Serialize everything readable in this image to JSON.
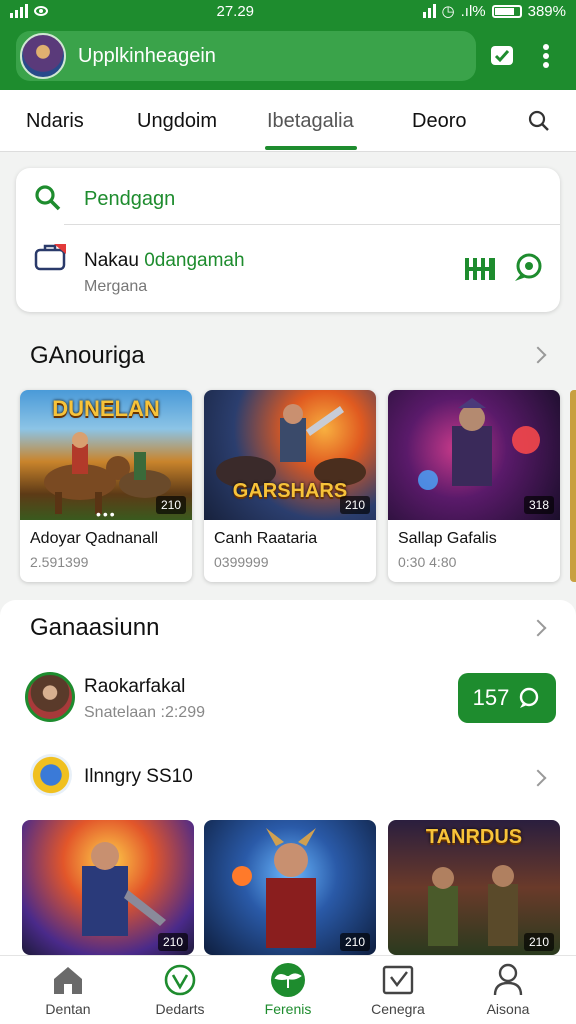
{
  "status_bar": {
    "time": "27.29",
    "battery": "389%",
    "extra": ".ıl%"
  },
  "app_bar": {
    "title": "Upplkinheagein"
  },
  "tabs": [
    {
      "label": "Ndaris"
    },
    {
      "label": "Ungdoim"
    },
    {
      "label": "Ibetagalia"
    },
    {
      "label": "Deoro"
    }
  ],
  "search_card": {
    "query": "Pendgagn",
    "message_title": "Nakau",
    "message_title_highlight": "0dangamah",
    "message_subtitle": "Mergana"
  },
  "section1": {
    "title": "GAnouriga",
    "games": [
      {
        "name": "Adoyar Qadnanall",
        "meta": "2.591399",
        "badge": "210",
        "art_text": "DUNELAN",
        "art_sub": ""
      },
      {
        "name": "Canh Raataria",
        "meta": "0399999",
        "badge": "210",
        "art_text": "GARSHARS",
        "art_sub": ""
      },
      {
        "name": "Sallap Gafalis",
        "meta": "0:30 4:80",
        "badge": "318",
        "art_text": "",
        "art_sub": ""
      }
    ]
  },
  "section2": {
    "title": "Ganaasiunn",
    "row1": {
      "title": "Raokarfakal",
      "subtitle": "Snatelaan :2:299",
      "count": "157"
    },
    "row2": {
      "title": "Ilnngry SS10"
    },
    "tiles": [
      {
        "badge": "210",
        "art_text": ""
      },
      {
        "badge": "210",
        "art_text": ""
      },
      {
        "badge": "210",
        "art_text": "TANRDUS"
      }
    ]
  },
  "bottom_nav": [
    {
      "label": "Dentan"
    },
    {
      "label": "Dedarts"
    },
    {
      "label": "Ferenis"
    },
    {
      "label": "Cenegra"
    },
    {
      "label": "Aisona"
    }
  ],
  "colors": {
    "brand_green": "#1e8c2e"
  }
}
